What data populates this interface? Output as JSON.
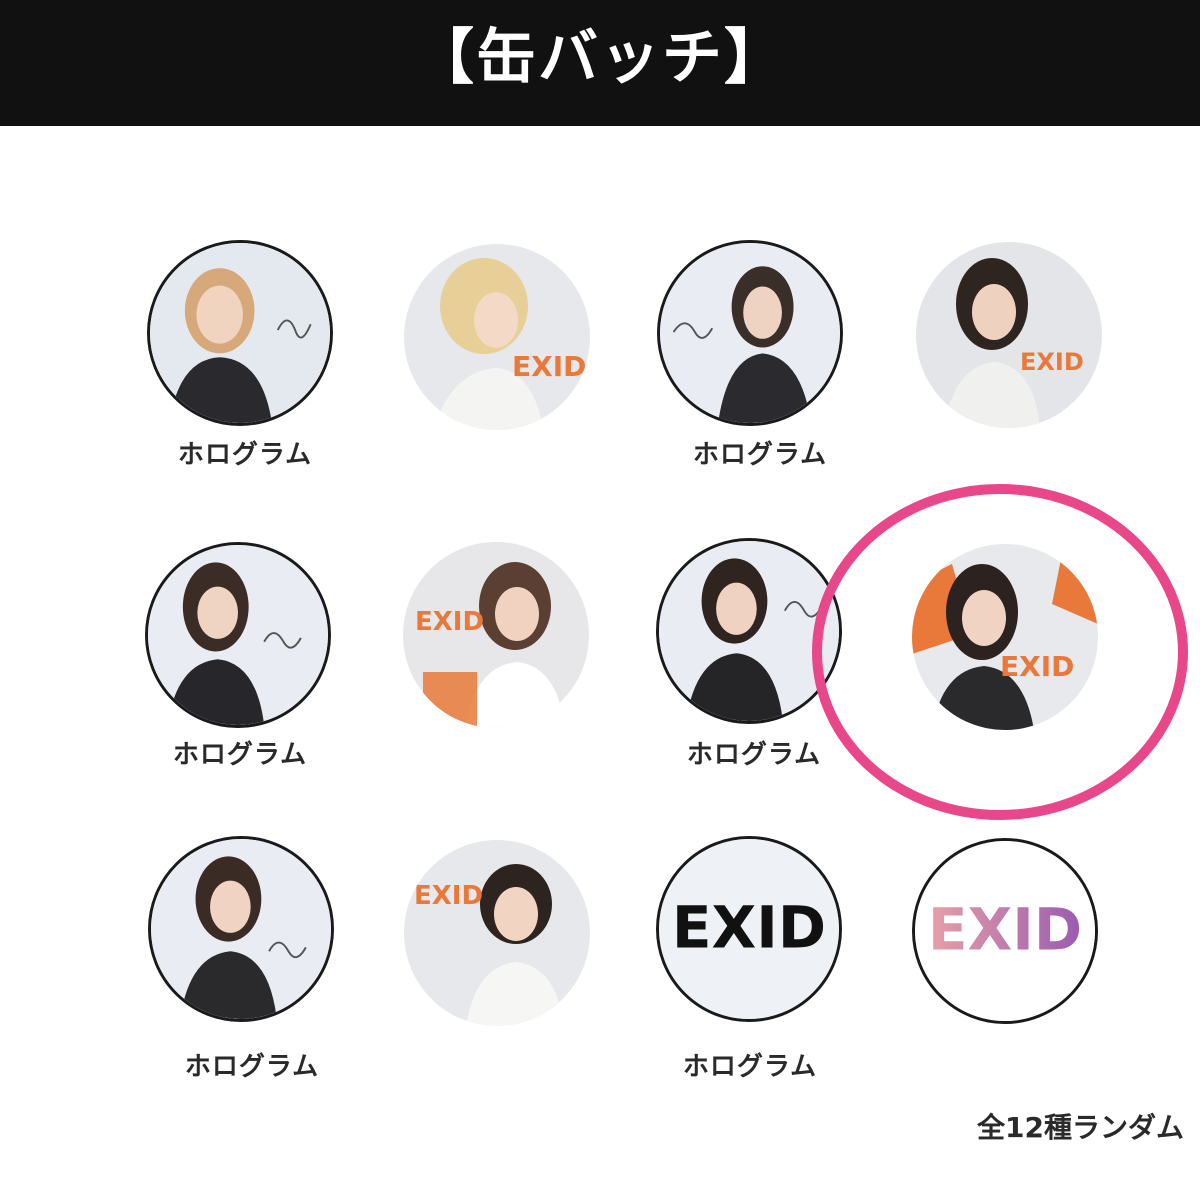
{
  "header": {
    "title": "【缶バッチ】",
    "background_color": "#111111"
  },
  "badges": [
    {
      "row": 1,
      "col": 1,
      "kind": "photo-with-signature",
      "caption": "ホログラム"
    },
    {
      "row": 1,
      "col": 2,
      "kind": "photo-with-logo",
      "caption": ""
    },
    {
      "row": 1,
      "col": 3,
      "kind": "photo-with-signature",
      "caption": "ホログラム"
    },
    {
      "row": 1,
      "col": 4,
      "kind": "photo-with-logo",
      "caption": ""
    },
    {
      "row": 2,
      "col": 1,
      "kind": "photo-with-signature",
      "caption": "ホログラム"
    },
    {
      "row": 2,
      "col": 2,
      "kind": "photo-with-logo",
      "caption": ""
    },
    {
      "row": 2,
      "col": 3,
      "kind": "photo-with-signature",
      "caption": "ホログラム"
    },
    {
      "row": 2,
      "col": 4,
      "kind": "photo-with-logo",
      "caption": "",
      "highlighted": true
    },
    {
      "row": 3,
      "col": 1,
      "kind": "photo-with-signature",
      "caption": "ホログラム"
    },
    {
      "row": 3,
      "col": 2,
      "kind": "photo-with-logo",
      "caption": ""
    },
    {
      "row": 3,
      "col": 3,
      "kind": "logo-black",
      "logo_text": "EXID",
      "caption": "ホログラム"
    },
    {
      "row": 3,
      "col": 4,
      "kind": "logo-gradient",
      "logo_text": "EXID",
      "caption": ""
    }
  ],
  "captions": {
    "r1c1": "ホログラム",
    "r1c3": "ホログラム",
    "r2c1": "ホログラム",
    "r2c3": "ホログラム",
    "r3c1": "ホログラム",
    "r3c3": "ホログラム"
  },
  "footnote": "全12種ランダム",
  "colors": {
    "highlight": "#e8478a",
    "logo_orange": "#e8793a",
    "logo_black": "#111111",
    "logo_gradient_start": "#e8a0a8",
    "logo_gradient_end": "#9a5bb0"
  }
}
